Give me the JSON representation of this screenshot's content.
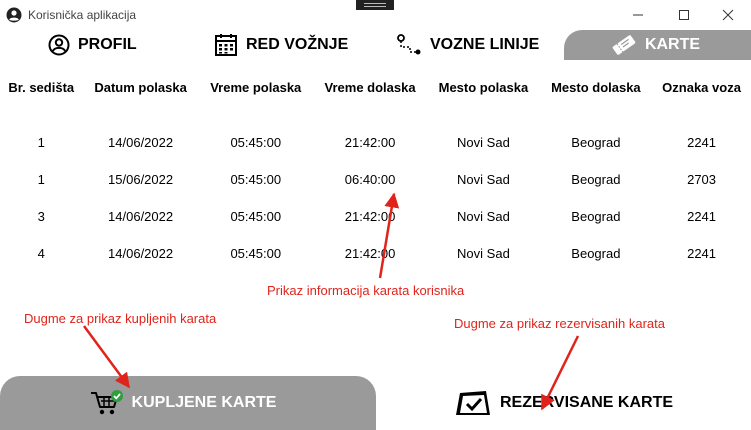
{
  "window": {
    "title": "Korisnička aplikacija",
    "icon": "user-circle-icon"
  },
  "tabs": [
    {
      "label": "PROFIL",
      "icon": "user-icon",
      "active": false
    },
    {
      "label": "RED VOŽNJE",
      "icon": "calendar-icon",
      "active": false
    },
    {
      "label": "VOZNE LINIJE",
      "icon": "route-icon",
      "active": false
    },
    {
      "label": "KARTE",
      "icon": "ticket-icon",
      "active": true
    }
  ],
  "table": {
    "columns": [
      "Br. sedišta",
      "Datum polaska",
      "Vreme polaska",
      "Vreme dolaska",
      "Mesto polaska",
      "Mesto dolaska",
      "Oznaka voza"
    ],
    "rows": [
      [
        "1",
        "14/06/2022",
        "05:45:00",
        "21:42:00",
        "Novi Sad",
        "Beograd",
        "2241"
      ],
      [
        "1",
        "15/06/2022",
        "05:45:00",
        "06:40:00",
        "Novi Sad",
        "Beograd",
        "2703"
      ],
      [
        "3",
        "14/06/2022",
        "05:45:00",
        "21:42:00",
        "Novi Sad",
        "Beograd",
        "2241"
      ],
      [
        "4",
        "14/06/2022",
        "05:45:00",
        "21:42:00",
        "Novi Sad",
        "Beograd",
        "2241"
      ]
    ]
  },
  "annotations": {
    "info": "Prikaz informacija karata korisnika",
    "kupljene": "Dugme za prikaz kupljenih karata",
    "rezervisane": "Dugme za prikaz rezervisanih karata"
  },
  "buttons": {
    "kupljene_label": "KUPLJENE KARTE",
    "rezervisane_label": "REZERVISANE KARTE"
  },
  "colors": {
    "active_tab": "#9a9a9a",
    "annotation": "#e0241b",
    "check_badge": "#2e9e3e"
  }
}
